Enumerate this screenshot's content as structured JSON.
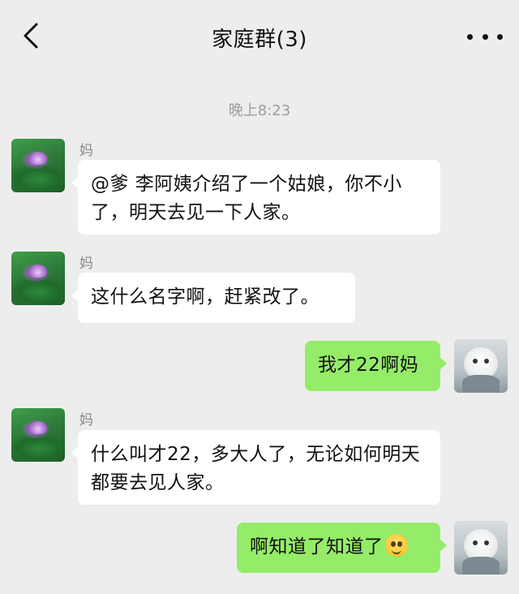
{
  "header": {
    "title": "家庭群(3)",
    "back_icon": "chevron-left-icon",
    "more_icon": "more-dots-icon"
  },
  "timestamp": "晚上8:23",
  "messages": [
    {
      "sender": "妈",
      "direction": "in",
      "text": "@爹 李阿姨介绍了一个姑娘，你不小了，明天去见一下人家。"
    },
    {
      "sender": "妈",
      "direction": "in",
      "text": "这什么名字啊，赶紧改了。"
    },
    {
      "sender": "",
      "direction": "out",
      "text": "我才22啊妈"
    },
    {
      "sender": "妈",
      "direction": "in",
      "text": "什么叫才22，多大人了，无论如何明天都要去见人家。"
    },
    {
      "sender": "",
      "direction": "out",
      "text": "啊知道了知道了",
      "emoji": "flushed-smile-emoji"
    }
  ],
  "colors": {
    "background": "#ededed",
    "incoming_bubble": "#ffffff",
    "outgoing_bubble": "#95ec69",
    "timestamp": "#9d9d9d"
  }
}
